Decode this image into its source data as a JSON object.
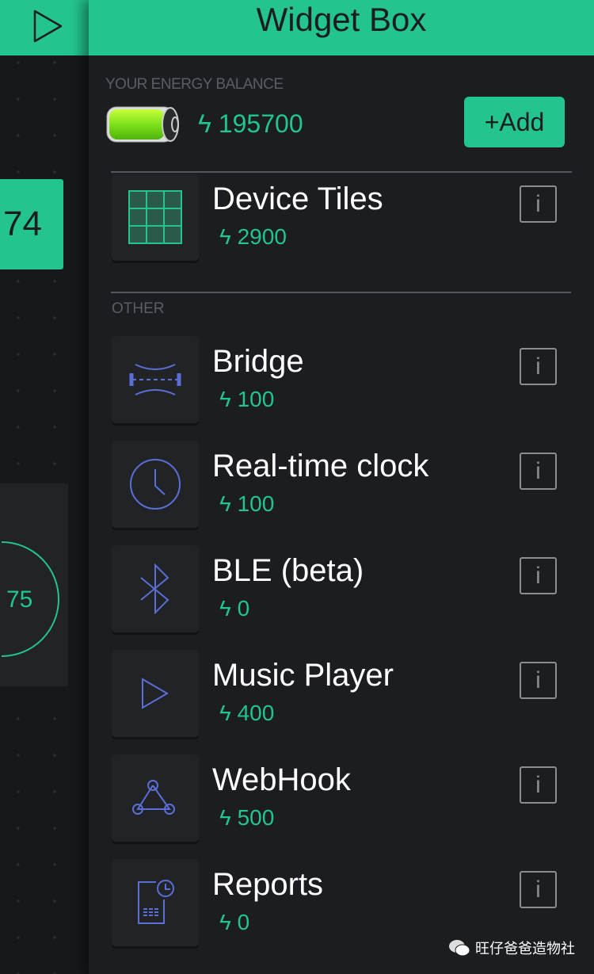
{
  "header": {
    "title": "Widget Box",
    "play_icon": "play-icon"
  },
  "background": {
    "tile_value": "74",
    "gauge_value": "75"
  },
  "energy": {
    "label": "YOUR ENERGY BALANCE",
    "balance": "ϟ 195700",
    "add_label": "+Add"
  },
  "section_other": "OTHER",
  "info_label": "i",
  "widgets": [
    {
      "name": "Device Tiles",
      "cost": "ϟ 2900",
      "icon": "grid-icon"
    },
    {
      "name": "Bridge",
      "cost": "ϟ 100",
      "icon": "bridge-icon"
    },
    {
      "name": "Real-time clock",
      "cost": "ϟ 100",
      "icon": "clock-icon"
    },
    {
      "name": "BLE (beta)",
      "cost": "ϟ 0",
      "icon": "bluetooth-icon"
    },
    {
      "name": "Music Player",
      "cost": "ϟ 400",
      "icon": "play-icon"
    },
    {
      "name": "WebHook",
      "cost": "ϟ 500",
      "icon": "webhook-icon"
    },
    {
      "name": "Reports",
      "cost": "ϟ 0",
      "icon": "report-icon"
    }
  ],
  "watermark": "旺仔爸爸造物社",
  "colors": {
    "accent": "#23c48e",
    "icon": "#5a6fd6",
    "bg": "#1c1d21"
  }
}
